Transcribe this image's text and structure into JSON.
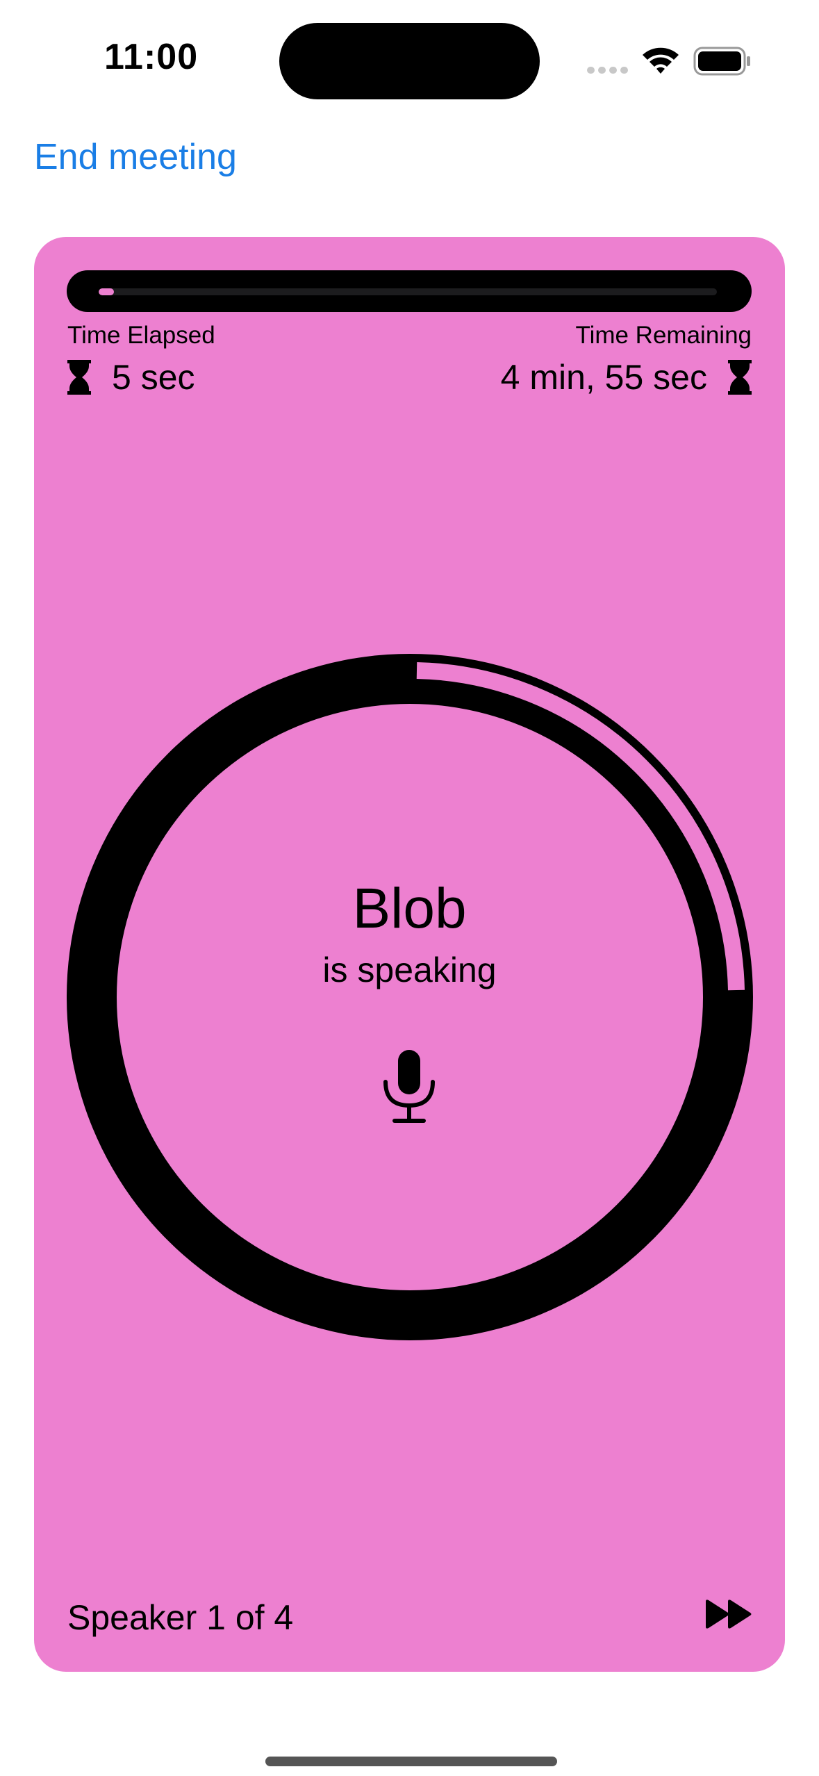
{
  "status_bar": {
    "time": "11:00",
    "icons": [
      "cellular-signal-icon",
      "wifi-icon",
      "battery-icon"
    ]
  },
  "nav": {
    "end_meeting_label": "End meeting"
  },
  "meeting": {
    "theme_color": "#ed80d0",
    "accent_color": "#1a7ee6",
    "progress_fraction": 0.0167,
    "time_elapsed_label": "Time Elapsed",
    "time_elapsed_value": "5 sec",
    "time_remaining_label": "Time Remaining",
    "time_remaining_value": "4 min, 55 sec",
    "speaker_name": "Blob",
    "speaker_status": "is speaking",
    "speaker_count_text": "Speaker 1 of 4",
    "speaker_index": 1,
    "speaker_total": 4,
    "icons": [
      "hourglass-icon",
      "mic-icon",
      "forward-icon"
    ]
  }
}
